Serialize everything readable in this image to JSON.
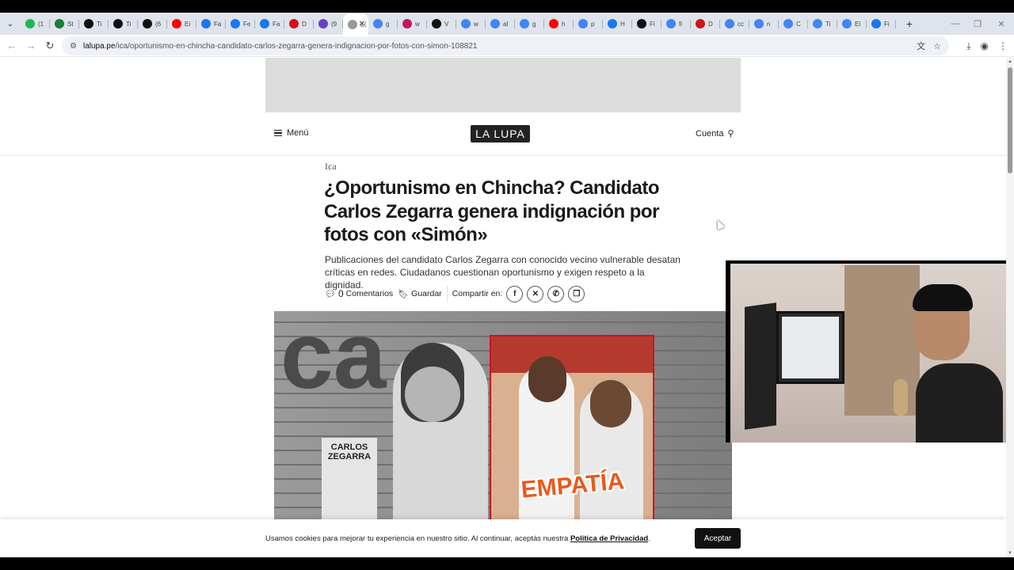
{
  "browser": {
    "tabs": [
      {
        "label": "(1",
        "icon": "spotify-icon",
        "color": "#1db954"
      },
      {
        "label": "St",
        "icon": "k-icon",
        "color": "#1a7f37"
      },
      {
        "label": "Ti",
        "icon": "tiktok-icon",
        "color": "#111111"
      },
      {
        "label": "Ti",
        "icon": "tiktok-icon",
        "color": "#111111"
      },
      {
        "label": "(6",
        "icon": "tiktok-icon",
        "color": "#111111"
      },
      {
        "label": "Ei",
        "icon": "youtube-icon",
        "color": "#ff0000"
      },
      {
        "label": "Fa",
        "icon": "facebook-icon",
        "color": "#1877f2"
      },
      {
        "label": "Fe",
        "icon": "facebook-icon",
        "color": "#1877f2"
      },
      {
        "label": "Fa",
        "icon": "facebook-icon",
        "color": "#1877f2"
      },
      {
        "label": "D",
        "icon": "red-circle-icon",
        "color": "#d0121b"
      },
      {
        "label": "(9",
        "icon": "threads-icon",
        "color": "#6a3fc8"
      },
      {
        "label": "¿(",
        "icon": "lalupa-icon",
        "color": "#999999",
        "active": true
      },
      {
        "label": "g",
        "icon": "google-icon",
        "color": "#4285f4"
      },
      {
        "label": "w",
        "icon": "star-icon",
        "color": "#c2185b"
      },
      {
        "label": "V",
        "icon": "x-icon",
        "color": "#111111"
      },
      {
        "label": "w",
        "icon": "google-icon",
        "color": "#4285f4"
      },
      {
        "label": "al",
        "icon": "google-icon",
        "color": "#4285f4"
      },
      {
        "label": "g",
        "icon": "google-icon",
        "color": "#4285f4"
      },
      {
        "label": "h",
        "icon": "youtube-icon",
        "color": "#ff0000"
      },
      {
        "label": "p",
        "icon": "google-icon",
        "color": "#4285f4"
      },
      {
        "label": "H",
        "icon": "facebook-icon",
        "color": "#1877f2"
      },
      {
        "label": "Fi",
        "icon": "tiktok-icon",
        "color": "#111111"
      },
      {
        "label": "fi",
        "icon": "google-icon",
        "color": "#4285f4"
      },
      {
        "label": "D",
        "icon": "red-circle-icon",
        "color": "#d0121b"
      },
      {
        "label": "cc",
        "icon": "google-icon",
        "color": "#4285f4"
      },
      {
        "label": "n",
        "icon": "google-icon",
        "color": "#4285f4"
      },
      {
        "label": "C",
        "icon": "google-icon",
        "color": "#4285f4"
      },
      {
        "label": "Ti",
        "icon": "google-icon",
        "color": "#4285f4"
      },
      {
        "label": "El",
        "icon": "google-icon",
        "color": "#4285f4"
      },
      {
        "label": "Fi",
        "icon": "facebook-icon",
        "color": "#1877f2"
      }
    ],
    "url_domain": "lalupa.pe",
    "url_path": "/ica/oportunismo-en-chincha-candidato-carlos-zegarra-genera-indignacion-por-fotos-con-simon-108821"
  },
  "site": {
    "menu_label": "Menú",
    "logo": "LA LUPA",
    "account_label": "Cuenta"
  },
  "article": {
    "category": "Ica",
    "title": "¿Oportunismo en Chincha? Candidato Carlos Zegarra genera indignación por fotos con «Simón»",
    "subtitle": "Publicaciones del candidato Carlos Zegarra con conocido vecino vulnerable desatan críticas en redes. Ciudadanos cuestionan oportunismo y exigen respeto a la dignidad.",
    "comments_count": "0",
    "comments_label": "Comentarios",
    "save_label": "Guardar",
    "share_label": "Compartir en:",
    "hero": {
      "poster_name": "CARLOS ZEGARRA",
      "overlay_word": "EMPATÍA"
    }
  },
  "cookie": {
    "text": "Usamos cookies para mejorar tu experiencia en nuestro sitio. Al continuar, aceptás nuestra",
    "link": "Política de Privacidad",
    "accept": "Aceptar"
  }
}
